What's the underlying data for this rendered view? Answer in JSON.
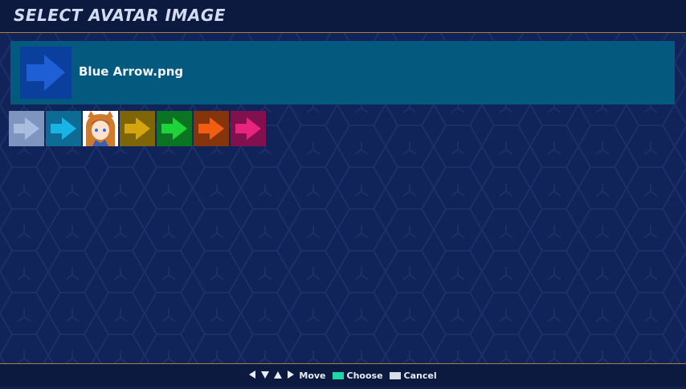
{
  "header": {
    "title": "SELECT AVATAR IMAGE"
  },
  "selected": {
    "name": "Blue Arrow.png",
    "icon": "arrow-right-icon",
    "color": "#1e5fd6"
  },
  "avatars": [
    {
      "name": "avatar-gray-arrow",
      "icon": "arrow-right-icon",
      "bg": "#7e95c0",
      "fg": "#a9bddf"
    },
    {
      "name": "avatar-cyan-arrow",
      "icon": "arrow-right-icon",
      "bg": "#0c6c96",
      "fg": "#18b4e6"
    },
    {
      "name": "avatar-character",
      "icon": "character-portrait-icon",
      "bg": "#ffffff",
      "fg": "#d07a2e"
    },
    {
      "name": "avatar-gold-arrow",
      "icon": "arrow-right-icon",
      "bg": "#7e6508",
      "fg": "#d4a50e"
    },
    {
      "name": "avatar-green-arrow",
      "icon": "arrow-right-icon",
      "bg": "#0b7422",
      "fg": "#1ed43a"
    },
    {
      "name": "avatar-orange-arrow",
      "icon": "arrow-right-icon",
      "bg": "#86340c",
      "fg": "#f25d12"
    },
    {
      "name": "avatar-magenta-arrow",
      "icon": "arrow-right-icon",
      "bg": "#82104e",
      "fg": "#e8247e"
    }
  ],
  "footer": {
    "move_label": "Move",
    "choose_label": "Choose",
    "cancel_label": "Cancel",
    "choose_color": "#1fd6a8",
    "cancel_color": "#d8dce4"
  }
}
